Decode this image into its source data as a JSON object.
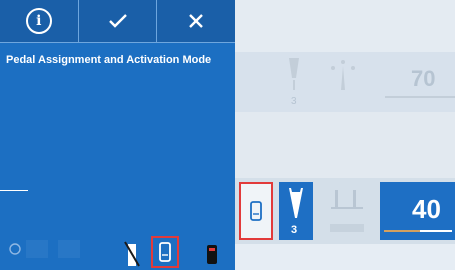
{
  "toolbar": {
    "info_icon": "info-icon",
    "confirm_icon": "check-icon",
    "close_icon": "close-icon"
  },
  "panel": {
    "title": "Pedal Assignment and Activation Mode"
  },
  "rows": {
    "row1": {
      "sub_value": "3",
      "value": "70"
    },
    "row3": {
      "sub_value": "3",
      "value": "40"
    }
  },
  "colors": {
    "panel_blue": "#1c6fc2",
    "toolbar_blue": "#1a5fa8",
    "highlight_red": "#e23a3a",
    "value_blue": "#1e6fc4"
  }
}
